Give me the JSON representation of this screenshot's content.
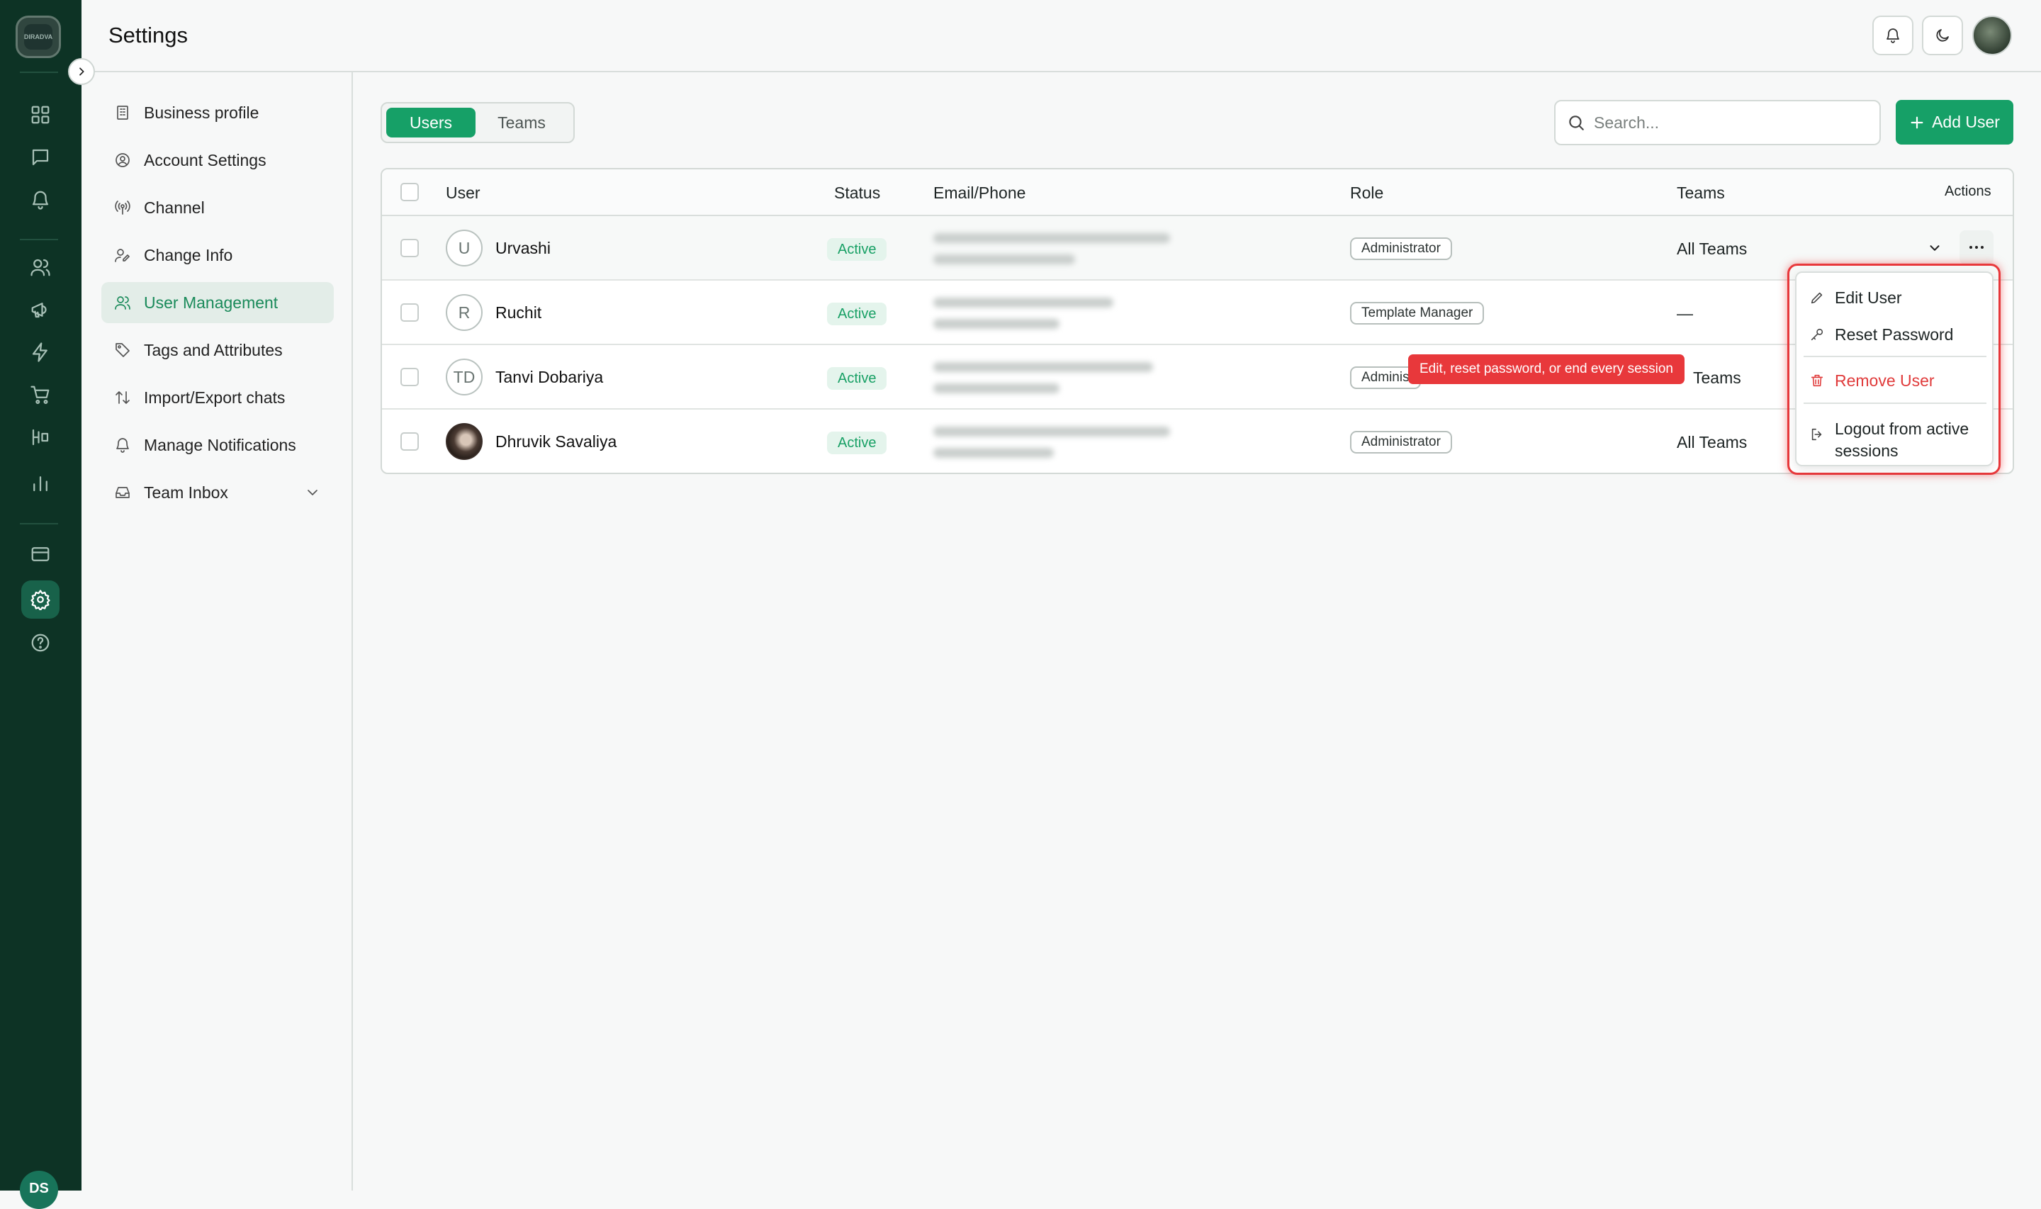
{
  "app": {
    "logo_text": "DIRADVA",
    "user_initials": "DS"
  },
  "header": {
    "title": "Settings"
  },
  "subnav": {
    "items": [
      {
        "label": "Business profile"
      },
      {
        "label": "Account Settings"
      },
      {
        "label": "Channel"
      },
      {
        "label": "Change Info"
      },
      {
        "label": "User Management",
        "active": true
      },
      {
        "label": "Tags and Attributes"
      },
      {
        "label": "Import/Export chats"
      },
      {
        "label": "Manage Notifications"
      },
      {
        "label": "Team Inbox",
        "expandable": true
      }
    ]
  },
  "tabs": {
    "users": "Users",
    "teams": "Teams",
    "active": "Users"
  },
  "search": {
    "placeholder": "Search..."
  },
  "add_user": {
    "label": "Add User"
  },
  "table": {
    "headers": {
      "user": "User",
      "status": "Status",
      "email_phone": "Email/Phone",
      "role": "Role",
      "teams": "Teams",
      "actions": "Actions"
    },
    "rows": [
      {
        "avatar": "U",
        "name": "Urvashi",
        "status": "Active",
        "role": "Administrator",
        "teams": "All Teams"
      },
      {
        "avatar": "R",
        "name": "Ruchit",
        "status": "Active",
        "role": "Template Manager",
        "teams": "—"
      },
      {
        "avatar": "TD",
        "name": "Tanvi Dobariya",
        "status": "Active",
        "role": "Adminis",
        "teams": "Teams"
      },
      {
        "avatar": "",
        "name": "Dhruvik Savaliya",
        "status": "Active",
        "role": "Administrator",
        "teams": "All Teams"
      }
    ]
  },
  "action_menu": {
    "edit": "Edit User",
    "reset": "Reset Password",
    "remove": "Remove User",
    "logout_line1": "Logout from active",
    "logout_line2": "sessions"
  },
  "tooltip": {
    "text": "Edit, reset password, or end every session"
  },
  "colors": {
    "primary": "#16a067",
    "rail": "#0d3325",
    "danger": "#e03b3b",
    "highlight": "#e8383b"
  }
}
